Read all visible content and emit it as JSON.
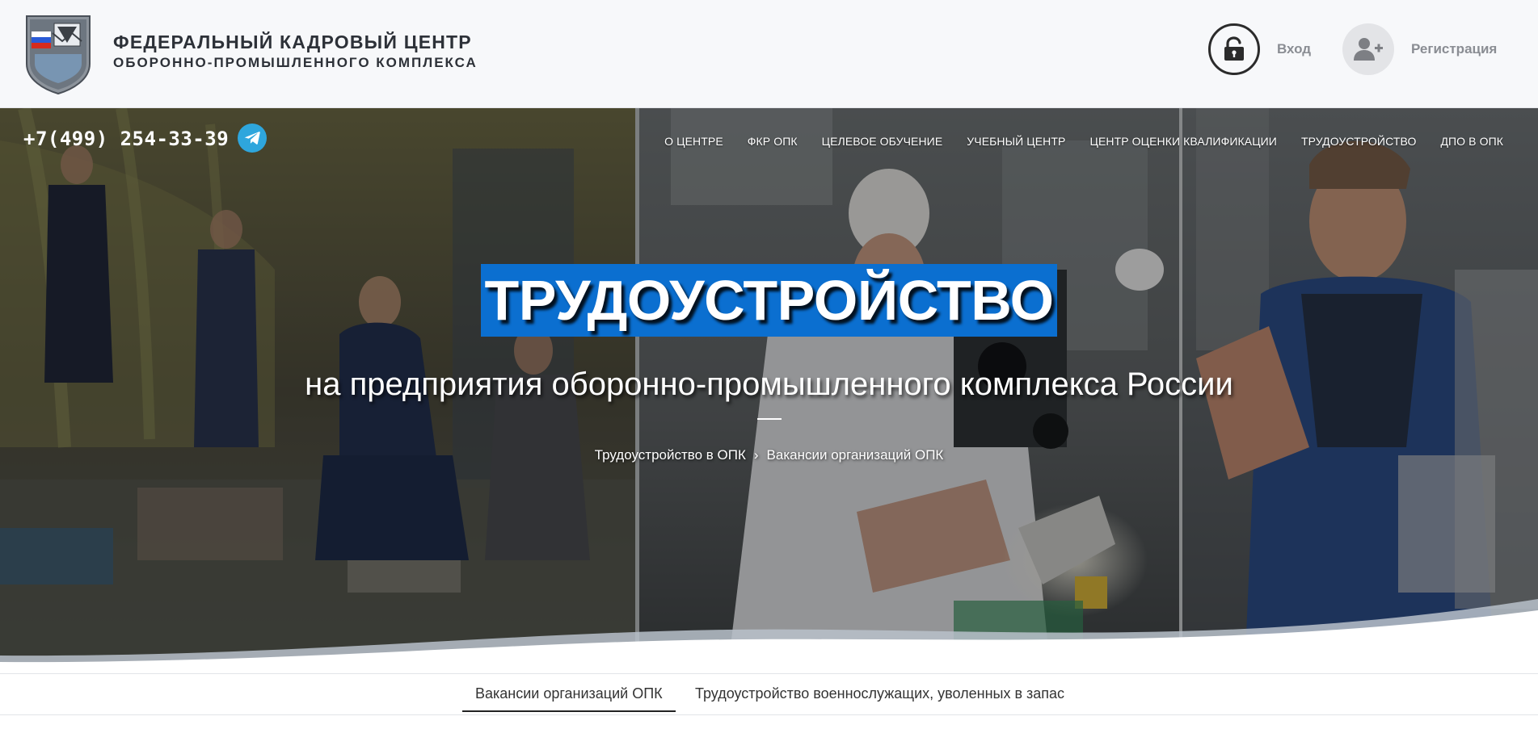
{
  "header": {
    "org_line1": "ФЕДЕРАЛЬНЫЙ КАДРОВЫЙ ЦЕНТР",
    "org_line2": "ОБОРОННО-ПРОМЫШЛЕННОГО КОМПЛЕКСА",
    "login_label": "Вход",
    "login_icon": "lock-open-icon",
    "register_label": "Регистрация",
    "register_icon": "user-plus-icon"
  },
  "hero": {
    "phone": "+7(499) 254-33-39",
    "telegram_icon": "telegram-icon",
    "nav": [
      {
        "label": "О ЦЕНТРЕ"
      },
      {
        "label": "ФКР ОПК"
      },
      {
        "label": "ЦЕЛЕВОЕ ОБУЧЕНИЕ"
      },
      {
        "label": "УЧЕБНЫЙ ЦЕНТР"
      },
      {
        "label": "ЦЕНТР ОЦЕНКИ КВАЛИФИКАЦИИ"
      },
      {
        "label": "ТРУДОУСТРОЙСТВО"
      },
      {
        "label": "ДПО В ОПК"
      }
    ],
    "title": "ТРУДОУСТРОЙСТВО",
    "subtitle": "на предприятия оборонно-промышленного комплекса России",
    "breadcrumb": [
      {
        "label": "Трудоустройство в ОПК"
      },
      {
        "label": "Вакансии организаций ОПК"
      }
    ],
    "breadcrumb_separator": "›"
  },
  "tabs": [
    {
      "label": "Вакансии организаций ОПК",
      "active": true
    },
    {
      "label": "Трудоустройство военнослужащих, уволенных в запас",
      "active": false
    }
  ],
  "colors": {
    "title_highlight": "#0b6fd0",
    "telegram": "#2ea6dd",
    "header_bg": "#f7f8fa"
  }
}
